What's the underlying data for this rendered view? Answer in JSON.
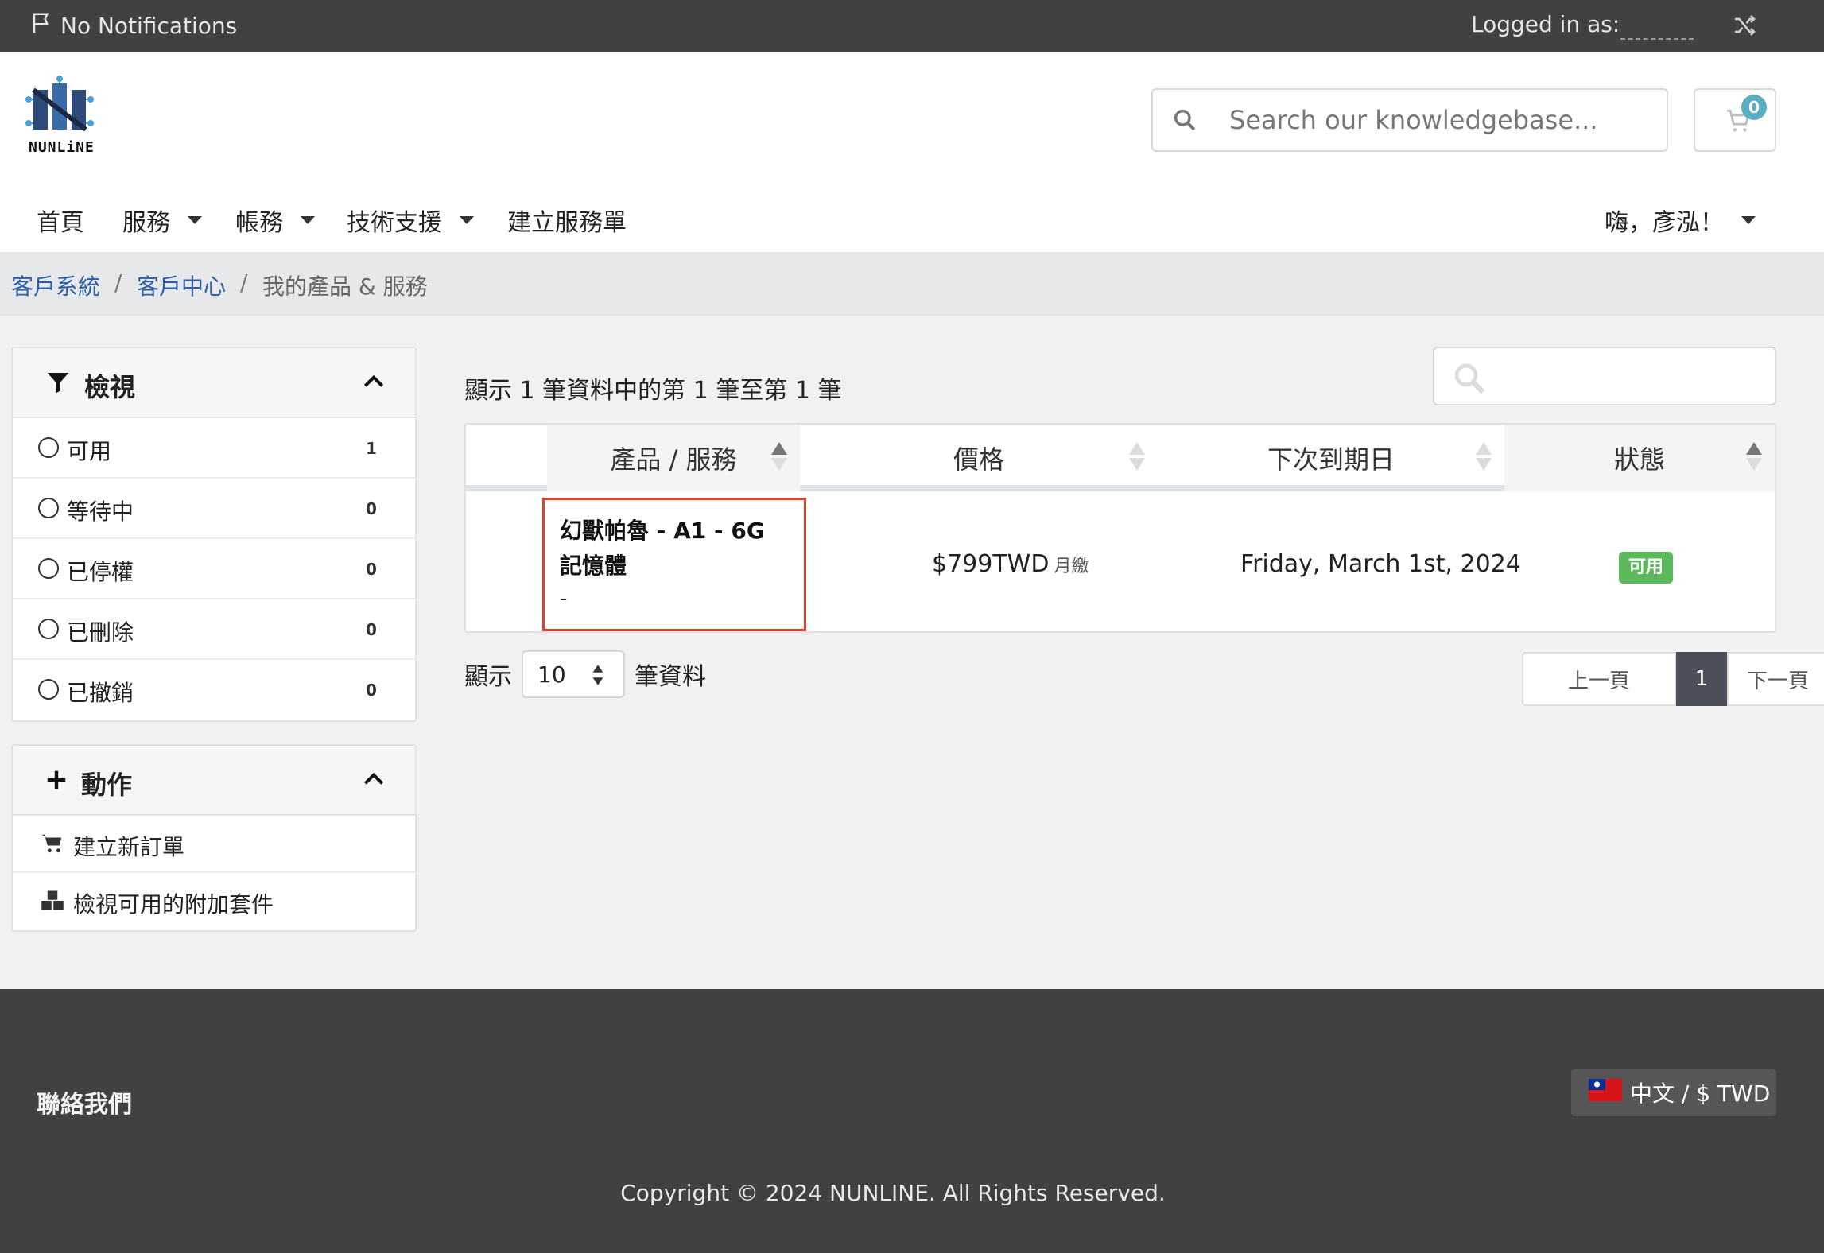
{
  "topbar": {
    "notifications": "No Notifications",
    "logged_in_as": "Logged in as:"
  },
  "header": {
    "logo_text": "NUNLiNE",
    "search_placeholder": "Search our knowledgebase...",
    "cart_count": "0"
  },
  "nav": {
    "items": [
      {
        "label": "首頁"
      },
      {
        "label": "服務"
      },
      {
        "label": "帳務"
      },
      {
        "label": "技術支援"
      },
      {
        "label": "建立服務單"
      }
    ],
    "user_greeting": "嗨，彥泓！"
  },
  "breadcrumb": {
    "items": [
      "客戶系統",
      "客戶中心",
      "我的產品 & 服務"
    ],
    "separator": "/"
  },
  "view_panel": {
    "title": "檢視",
    "items": [
      {
        "label": "可用",
        "count": "1"
      },
      {
        "label": "等待中",
        "count": "0"
      },
      {
        "label": "已停權",
        "count": "0"
      },
      {
        "label": "已刪除",
        "count": "0"
      },
      {
        "label": "已撤銷",
        "count": "0"
      }
    ]
  },
  "actions_panel": {
    "title": "動作",
    "items": [
      {
        "label": "建立新訂單",
        "icon": "cart-icon"
      },
      {
        "label": "檢視可用的附加套件",
        "icon": "cubes-icon"
      }
    ]
  },
  "table": {
    "summary": "顯示 1 筆資料中的第 1 筆至第 1 筆",
    "columns": [
      "產品 / 服務",
      "價格",
      "下次到期日",
      "狀態"
    ],
    "rows": [
      {
        "product": "幻獸帕魯 - A1 - 6G 記憶體",
        "product_sub": "-",
        "price": "$799TWD",
        "cycle": "月繳",
        "due": "Friday, March 1st, 2024",
        "status": "可用"
      }
    ]
  },
  "length_menu": {
    "prefix": "顯示",
    "value": "10",
    "suffix": "筆資料"
  },
  "pagination": {
    "prev": "上一頁",
    "current": "1",
    "next": "下一頁"
  },
  "footer": {
    "contact": "聯絡我們",
    "language": "中文 / $ TWD",
    "copyright": "Copyright © 2024 NUNLINE. All Rights Reserved."
  },
  "colors": {
    "topbar": "#414141",
    "link": "#2d5fa8",
    "status_active": "#5cb85c",
    "highlight": "#d9442f",
    "cart_badge": "#5aaec2"
  }
}
